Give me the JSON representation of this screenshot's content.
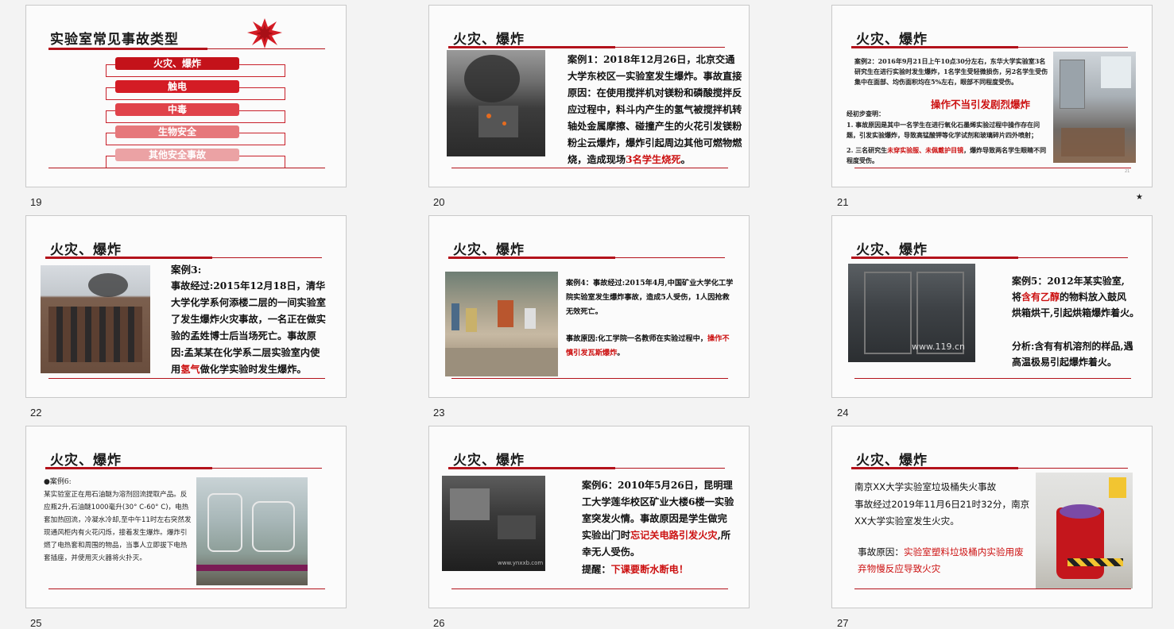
{
  "slides": [
    {
      "number": "19",
      "title": "实验室常见事故类型",
      "items": [
        "火灾、爆炸",
        "触电",
        "中毒",
        "生物安全",
        "其他安全事故"
      ],
      "colors": [
        "#c4121a",
        "#d41c25",
        "#e0424a",
        "#e6787b",
        "#eba2a4"
      ]
    },
    {
      "number": "20",
      "title": "火灾、爆炸",
      "body_parts": [
        "案例1：2018年12月26日，北京交通大学东校区一实验室发生爆炸。事故直接原因：在使用搅拌机对镁粉和磷酸搅拌反应过程中，料斗内产生的氢气被搅拌机转轴处金属摩擦、碰撞产生的火花引发镁粉粉尘云爆炸，爆炸引起周边其他可燃物燃烧，造成现场",
        "3名学生烧死",
        "。"
      ]
    },
    {
      "number": "21",
      "title": "火灾、爆炸",
      "case_text": "案例2：2016年9月21日上午10点30分左右，东华大学实验室3名研究生在进行实验时发生爆炸，1名学生受轻微损伤，另2名学生受伤集中在面部、均伤面积均在5%左右，眼部不同程度受伤。",
      "highlight": "操作不当引发剧烈爆炸",
      "summary_label": "经初步查明：",
      "point1": "1. 事故原因是其中一名学生在进行氧化石墨烯实验过程中操作存在问题，引发实验爆炸，导致高锰酸钾等化学试剂和玻璃碎片四外喷射；",
      "point2_prefix": "2. 三名研究生",
      "point2_red": "未穿实验服、未佩戴护目镜",
      "point2_suffix": "，爆炸导致两名学生眼睛不同程度受伤。",
      "page_mark": "21",
      "star": "★"
    },
    {
      "number": "22",
      "title": "火灾、爆炸",
      "label": "案例3:",
      "body_prefix": "事故经过:2015年12月18日，清华大学化学系何添楼二层的一间实验室了发生爆炸火灾事故，一名正在做实验的孟姓博士后当场死亡。事故原因:孟某某在化学系二层实验室内使用",
      "body_red": "氢气",
      "body_suffix": "做化学实验时发生爆炸。"
    },
    {
      "number": "23",
      "title": "火灾、爆炸",
      "case": "案例4：事故经过:2015年4月,中国矿业大学化工学院实验室发生爆炸事故，造成5人受伤，1人因抢救无效死亡。",
      "cause_prefix": "事故原因:化工学院一名教师在实验过程中，",
      "cause_red": "操作不慎引发瓦斯爆炸",
      "cause_suffix": "。"
    },
    {
      "number": "24",
      "title": "火灾、爆炸",
      "line1": "案例5：2012年某实验室,",
      "line2_prefix": "将",
      "line2_red": "含有乙醇",
      "line2_suffix": "的物料放入鼓风",
      "line3": "烘箱烘干,引起烘箱爆炸着火。",
      "analysis": "分析:含有有机溶剂的样品,遇高温极易引起爆炸着火。",
      "watermark": "www.119.cn"
    },
    {
      "number": "25",
      "title": "火灾、爆炸",
      "label": "●案例6:",
      "body": "某实验室正在用石油醚为溶剂回流提取产品。反应瓶2升,石油醚1000毫升(30° C-60° C)，电热套加热回流，冷凝水冷却,至中午11时左右突然发现通风柜内有火花闪烁，接着发生爆炸。爆炸引燃了电热套和周围的物品，当事人立即拔下电热套插座，并使用灭火器将火扑灭。"
    },
    {
      "number": "26",
      "title": "火灾、爆炸",
      "body_prefix": "案例6：2010年5月26日，昆明理工大学莲华校区矿业大楼6楼一实验室突发火情。事故原因是学生做完实验出门时",
      "body_red": "忘记关电路引发火灾",
      "body_suffix": ",所幸无人受伤。",
      "tip_label": "提醒：",
      "tip_red": "下课要断水断电！",
      "watermark": "www.ynxxb.com"
    },
    {
      "number": "27",
      "title": "火灾、爆炸",
      "line1": "南京XX大学实验室垃圾桶失火事故",
      "line2": "事故经过2019年11月6日21时32分，南京XX大学实验室发生火灾。",
      "cause_label": "事故原因：",
      "cause_red": "实验室塑料垃圾桶内实验用废弃物慢反应导致火灾"
    }
  ]
}
